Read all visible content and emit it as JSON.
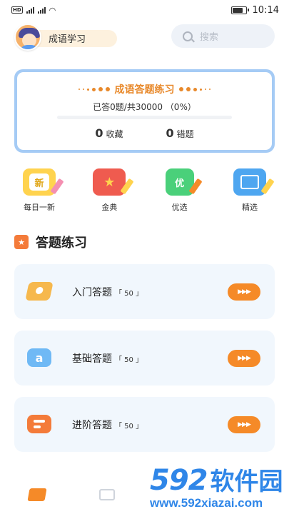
{
  "status_bar": {
    "left_indicators": "HD 4G",
    "time": "10:14",
    "battery_level": 0.85
  },
  "header": {
    "user_label": "成语学习",
    "search_placeholder": "搜索"
  },
  "progress_card": {
    "title": "成语答题练习",
    "stats": "已答0题/共30000 （0%）",
    "progress_fraction": 0,
    "favorites": {
      "count": "0",
      "label": "收藏"
    },
    "wrong": {
      "count": "0",
      "label": "错题"
    }
  },
  "shortcuts": [
    {
      "label": "每日一新",
      "glyph": "新",
      "icon": "new-icon"
    },
    {
      "label": "金典",
      "glyph": "★",
      "icon": "star-book-icon"
    },
    {
      "label": "优选",
      "glyph": "优",
      "icon": "scroll-icon"
    },
    {
      "label": "精选",
      "glyph": "",
      "icon": "open-book-icon"
    }
  ],
  "section": {
    "title": "答题练习"
  },
  "levels": [
    {
      "label": "入门答题",
      "count": "「 50 」",
      "icon": "ticket-icon",
      "icon_glyph": ""
    },
    {
      "label": "基础答题",
      "count": "「 50 」",
      "icon": "letter-a-icon",
      "icon_glyph": "a"
    },
    {
      "label": "进阶答题",
      "count": "「 50 」",
      "icon": "lines-icon",
      "icon_glyph": ""
    }
  ],
  "play_glyph": "▶▶▶",
  "watermark": {
    "brand_num": "592",
    "brand_cn": "软件园",
    "url": "www.592xiazai.com"
  },
  "colors": {
    "accent": "#f58a28",
    "card_border": "#a5cbf5",
    "card_bg": "#f1f7fd",
    "watermark": "#2f86e8"
  }
}
